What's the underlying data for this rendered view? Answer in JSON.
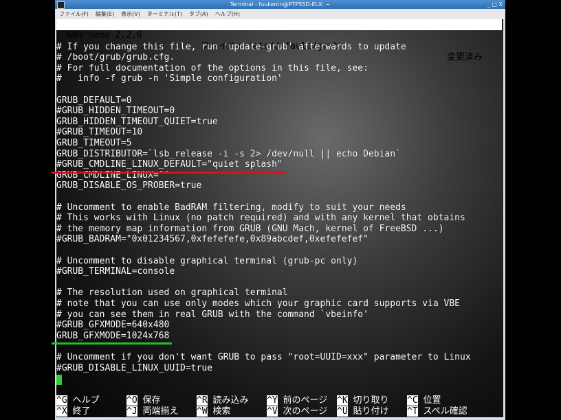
{
  "window": {
    "title": "Terminal - fuukemn@P7P55D-ELX: ~",
    "controls": "_ □ X"
  },
  "menu": [
    "ファイル(F)",
    "編集(E)",
    "表示(V)",
    "ターミナル(T)",
    "タブ(A)",
    "ヘルプ(H)"
  ],
  "nano": {
    "version": "GNU nano 2.2.6",
    "file": "ファイル: /etc/default/grub",
    "status": "変更済み"
  },
  "lines": [
    "",
    "# If you change this file, run 'update-grub' afterwards to update",
    "# /boot/grub/grub.cfg.",
    "# For full documentation of the options in this file, see:",
    "#   info -f grub -n 'Simple configuration'",
    "",
    "GRUB_DEFAULT=0",
    "#GRUB_HIDDEN_TIMEOUT=0",
    "GRUB_HIDDEN_TIMEOUT_QUIET=true",
    "#GRUB_TIMEOUT=10",
    "GRUB_TIMEOUT=5",
    "GRUB_DISTRIBUTOR=`lsb_release -i -s 2> /dev/null || echo Debian`",
    "#GRUB_CMDLINE_LINUX_DEFAULT=\"quiet splash\"",
    "GRUB_CMDLINE_LINUX=\"\"",
    "GRUB_DISABLE_OS_PROBER=true",
    "",
    "# Uncomment to enable BadRAM filtering, modify to suit your needs",
    "# This works with Linux (no patch required) and with any kernel that obtains",
    "# the memory map information from GRUB (GNU Mach, kernel of FreeBSD ...)",
    "#GRUB_BADRAM=\"0x01234567,0xfefefefe,0x89abcdef,0xefefefef\"",
    "",
    "# Uncomment to disable graphical terminal (grub-pc only)",
    "#GRUB_TERMINAL=console",
    "",
    "# The resolution used on graphical terminal",
    "# note that you can use only modes which your graphic card supports via VBE",
    "# you can see them in real GRUB with the command `vbeinfo'",
    "#GRUB_GFXMODE=640x480",
    "GRUB_GFXMODE=1024x768",
    "",
    "# Uncomment if you don't want GRUB to pass \"root=UUID=xxx\" parameter to Linux",
    "#GRUB_DISABLE_LINUX_UUID=true"
  ],
  "shortcuts": [
    {
      "key": "^G",
      "label": "ヘルプ"
    },
    {
      "key": "^O",
      "label": "保存"
    },
    {
      "key": "^R",
      "label": "読み込み"
    },
    {
      "key": "^Y",
      "label": "前のページ"
    },
    {
      "key": "^K",
      "label": "切り取り"
    },
    {
      "key": "^C",
      "label": "位置"
    },
    {
      "key": "^X",
      "label": "終了"
    },
    {
      "key": "^J",
      "label": "両端揃え"
    },
    {
      "key": "^W",
      "label": "検索"
    },
    {
      "key": "^V",
      "label": "次のページ"
    },
    {
      "key": "^U",
      "label": "貼り付け"
    },
    {
      "key": "^T",
      "label": "スペル確認"
    }
  ],
  "highlights": {
    "red": "#e0101a",
    "green": "#22c022"
  }
}
